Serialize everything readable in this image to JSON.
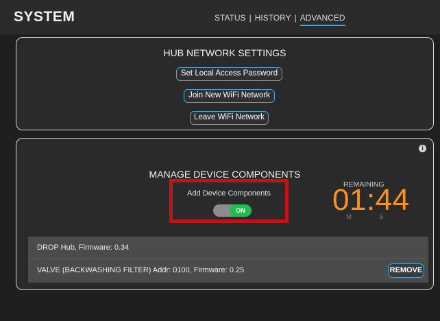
{
  "header": {
    "title": "SYSTEM",
    "tabs": [
      {
        "label": "STATUS"
      },
      {
        "label": "HISTORY"
      },
      {
        "label": "ADVANCED"
      }
    ],
    "separator": "|",
    "active_tab": "ADVANCED"
  },
  "hub_network": {
    "title": "HUB NETWORK SETTINGS",
    "buttons": [
      {
        "label": "Set Local Access Password"
      },
      {
        "label": "Join New WiFi Network"
      },
      {
        "label": "Leave WiFi Network"
      }
    ]
  },
  "manage_components": {
    "title": "MANAGE DEVICE COMPONENTS",
    "info_icon": "info-icon",
    "add_components": {
      "label": "Add Device Components",
      "toggle_state": "ON"
    },
    "timer": {
      "label": "REMAINING",
      "value": "01:44",
      "minutes_unit": "M",
      "seconds_unit": "S"
    },
    "devices": [
      {
        "text": "DROP Hub,  Firmware: 0.34"
      },
      {
        "text": "VALVE (BACKWASHING FILTER)  Addr: 0100, Firmware: 0.25",
        "action_label": "REMOVE"
      }
    ]
  },
  "colors": {
    "background": "#1f1f1f",
    "panel": "#2a2a2a",
    "accent_blue": "#45a6d6",
    "timer_orange": "#f7921e",
    "toggle_on_green": "#1dbd4e",
    "highlight_red": "#c4121a"
  }
}
